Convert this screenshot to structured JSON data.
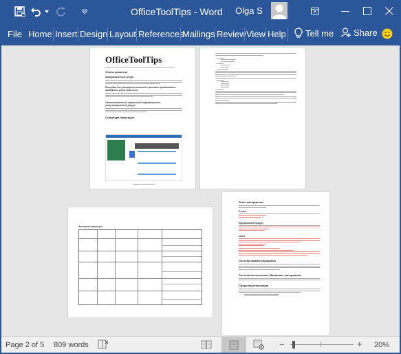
{
  "titlebar": {
    "document_name": "OfficeToolTips",
    "separator": "-",
    "app_name": "Word",
    "title": "OfficeToolTips  -  Word",
    "user_name": "Olga S",
    "qat": [
      {
        "name": "save-icon"
      },
      {
        "name": "undo-icon"
      },
      {
        "name": "undo-dropdown-icon"
      },
      {
        "name": "redo-icon"
      },
      {
        "name": "customize-qat-icon"
      }
    ],
    "window_controls": [
      "ribbon-display-options",
      "minimize",
      "maximize",
      "close"
    ]
  },
  "ribbon": {
    "tabs": [
      {
        "label": "File"
      },
      {
        "label": "Home"
      },
      {
        "label": "Insert"
      },
      {
        "label": "Design"
      },
      {
        "label": "Layout"
      },
      {
        "label": "References"
      },
      {
        "label": "Mailings"
      },
      {
        "label": "Review"
      },
      {
        "label": "View"
      },
      {
        "label": "Help"
      }
    ],
    "tell_me": "Tell me",
    "share": "Share",
    "feedback_icon": "smiley-icon"
  },
  "document": {
    "page1": {
      "title": "OfficeToolTips",
      "section1": "Этапы развития",
      "sub1": "Информационный ресурс",
      "sub2": "Площадка для размещения описаний и рекламы продвигаемых продуктов, услуг, книг и т.п.",
      "sub3": "Самостоятельный справочный информационно-консультационный ресурс",
      "section2": "Структура навигации"
    },
    "page2": {
      "list_items": [
        "Word",
        "Books and Translating",
        "Word and Reports",
        "Excel",
        "Formulas",
        "Solutions",
        "PowerPoint",
        "Word",
        "Word 97",
        "Word 2003",
        "Word 2007",
        "Word 2010",
        "Excel"
      ]
    },
    "page3": {
      "section": "Алгоритм навигации"
    },
    "page4": {
      "section1": "Типы материалов",
      "sub1": "Статьи",
      "sub2": "Программный продукт",
      "sub3": "Книги",
      "section2": "Система комментирования",
      "section3": "Система вычисления «Влияния» материалов",
      "section4": "Средства реализации"
    }
  },
  "statusbar": {
    "page_info": "Page 2 of 5",
    "word_count": "809 words",
    "proofing_icon": "proofing-icon",
    "views": [
      {
        "name": "read-mode",
        "active": false
      },
      {
        "name": "print-layout",
        "active": true
      },
      {
        "name": "web-layout",
        "active": false
      }
    ],
    "zoom_out": "−",
    "zoom_in": "+",
    "zoom_level": "20%",
    "zoom_percent": 20
  },
  "colors": {
    "accent": "#2b579a",
    "canvas": "#e6e6e6",
    "statusbar": "#f0f0f0"
  }
}
